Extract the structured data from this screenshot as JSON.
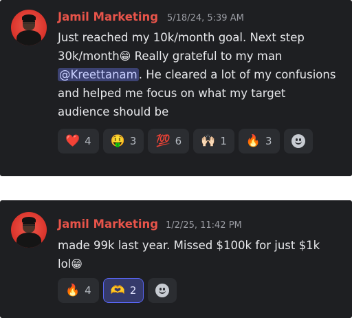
{
  "messages": [
    {
      "author": "Jamil Marketing",
      "timestamp": "5/18/24, 5:39 AM",
      "text_part1": "Just reached my 10k/month goal. Next step 30k/month",
      "emoji1": "😁",
      "text_part2": " Really grateful to my man ",
      "mention": "@Kreettanam",
      "text_part3": ". He cleared a lot of my confusions and helped me focus on what my target audience should be",
      "reactions": [
        {
          "emoji": "❤️",
          "icon": "heart-icon",
          "count": "4"
        },
        {
          "emoji": "🤑",
          "icon": "money-mouth-face-icon",
          "count": "3"
        },
        {
          "emoji": "💯",
          "icon": "hundred-points-icon",
          "count": "6"
        },
        {
          "emoji": "🙌🏻",
          "icon": "raising-hands-icon",
          "count": "1"
        },
        {
          "emoji": "🔥",
          "icon": "fire-icon",
          "count": "3"
        }
      ]
    },
    {
      "author": "Jamil Marketing",
      "timestamp": "1/2/25, 11:42 PM",
      "text_part1": "made 99k last year. Missed $100k for just $1k lol",
      "emoji1": "😁",
      "reactions": [
        {
          "emoji": "🔥",
          "icon": "fire-icon",
          "count": "4"
        },
        {
          "emoji": "🫶",
          "icon": "heart-hands-icon",
          "count": "2",
          "active": true
        }
      ]
    }
  ],
  "colors": {
    "background": "#1e1f22",
    "author": "#e8544a",
    "mention_bg": "#3c4272",
    "reaction_bg": "#2b2d31",
    "reaction_active_border": "#5865f2"
  },
  "add_reaction_icon": "add-reaction-smile-icon"
}
